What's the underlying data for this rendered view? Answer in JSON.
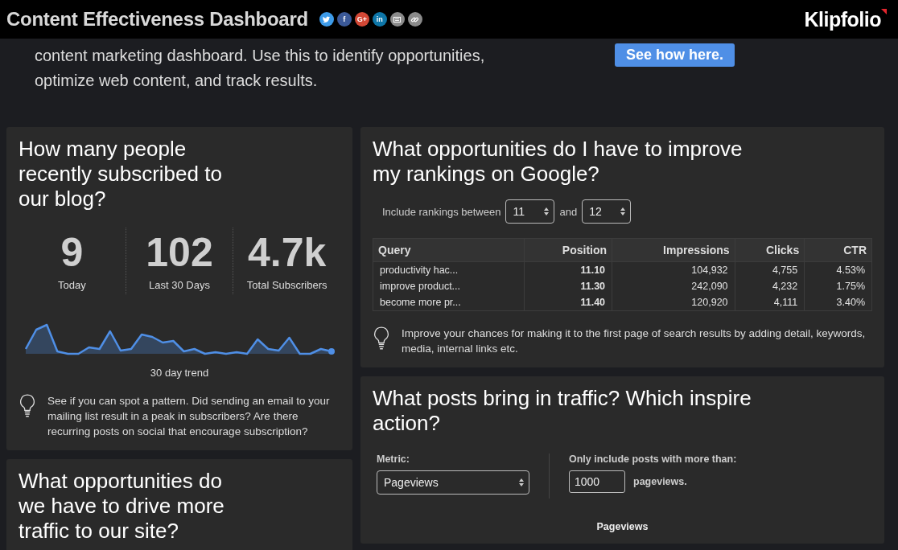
{
  "header": {
    "title": "Content Effectiveness Dashboard",
    "logo": "Klipfolio",
    "share_buttons": [
      {
        "kind": "twitter",
        "color": "#3d9be9"
      },
      {
        "kind": "facebook",
        "label": "f",
        "color": "#3b5998"
      },
      {
        "kind": "google",
        "label": "G+",
        "color": "#d34836"
      },
      {
        "kind": "linkedin",
        "label": "in",
        "color": "#0e76a8"
      },
      {
        "kind": "email",
        "color": "#8a8a8a"
      },
      {
        "kind": "link",
        "color": "#8a8a8a"
      }
    ]
  },
  "intro": {
    "lines": [
      "content marketing dashboard. Use this to identify opportunities,",
      "optimize web content, and track results."
    ],
    "button": "See how here."
  },
  "subscribers": {
    "title": "How many people recently subscribed to our blog?",
    "stats": [
      {
        "value": "9",
        "label": "Today"
      },
      {
        "value": "102",
        "label": "Last 30 Days"
      },
      {
        "value": "4.7k",
        "label": "Total Subscribers"
      }
    ],
    "trend_label": "30 day trend",
    "tip": "See if you can spot a pattern. Did sending an email to your mailing list result in a peak in subscribers? Are there recurring posts on social that encourage subscription?"
  },
  "rankings": {
    "title": "What opportunities do I have to improve my rankings on Google?",
    "filter_label": "Include rankings between",
    "from": "11",
    "joiner": "and",
    "to": "12",
    "columns": [
      "Query",
      "Position",
      "Impressions",
      "Clicks",
      "CTR"
    ],
    "rows": [
      [
        "productivity hac...",
        "11.10",
        "104,932",
        "4,755",
        "4.53%"
      ],
      [
        "improve product...",
        "11.30",
        "242,090",
        "4,232",
        "1.75%"
      ],
      [
        "become more pr...",
        "11.40",
        "120,920",
        "4,111",
        "3.40%"
      ]
    ],
    "tip": "Improve your chances for making it to the first page of search results by adding detail, keywords, media, internal links etc."
  },
  "posts": {
    "title": "What posts bring in traffic? Which inspire action?",
    "metric_label": "Metric:",
    "metric": "Pageviews",
    "threshold_label": "Only include posts with more than:",
    "threshold": "1000",
    "threshold_unit": "pageviews.",
    "chart_title": "Pageviews"
  },
  "traffic": {
    "title": "What opportunities do we have to drive more traffic to our site?"
  }
}
